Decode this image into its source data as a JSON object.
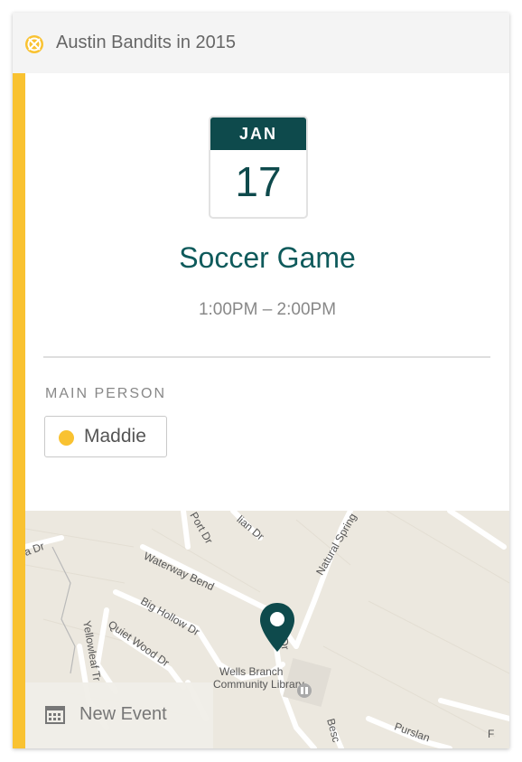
{
  "header": {
    "title": "Austin Bandits in 2015",
    "logo_icon": "soccer-ball-icon",
    "accent_color": "#f9c231"
  },
  "event": {
    "month": "JAN",
    "day": "17",
    "title": "Soccer Game",
    "time": "1:00PM – 2:00PM"
  },
  "main_person": {
    "label": "MAIN PERSON",
    "name": "Maddie",
    "color": "#f9c231"
  },
  "map": {
    "streets": [
      "ia Dr",
      "Port Dr",
      "lian Dr",
      "Natural Spring",
      "Waterway Bend",
      "Big Hollow Dr",
      "Quiet Wood Dr",
      "Yellowleaf Tr",
      "Wells Branch",
      "Community Library",
      "Port Dr",
      "Besc",
      "Purslan",
      "F"
    ],
    "pin_icon": "map-pin-icon",
    "library_icon": "library-icon"
  },
  "footer": {
    "new_event_label": "New Event",
    "new_event_icon": "calendar-icon"
  },
  "colors": {
    "brand_dark": "#0e4a4c",
    "accent": "#f9c231"
  }
}
